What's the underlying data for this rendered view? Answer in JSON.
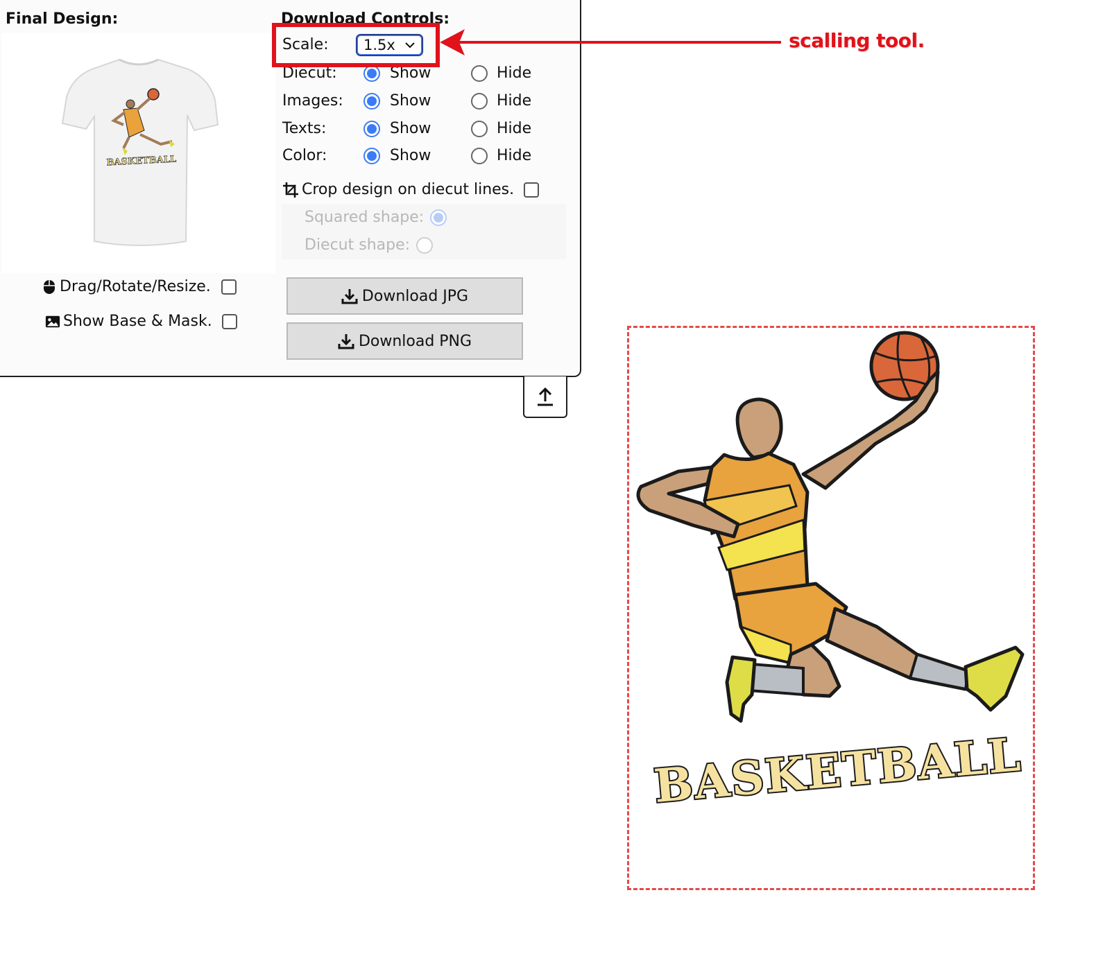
{
  "final_design": {
    "title": "Final Design:",
    "tshirt_print_text": "BASKETBALL",
    "drag_label": "Drag/Rotate/Resize.",
    "show_mask_label": "Show Base & Mask."
  },
  "controls": {
    "title": "Download Controls:",
    "scale_label": "Scale:",
    "scale_value": "1.5x",
    "rows": [
      {
        "label": "Diecut:",
        "show": "Show",
        "hide": "Hide",
        "selected": "Show"
      },
      {
        "label": "Images:",
        "show": "Show",
        "hide": "Hide",
        "selected": "Show"
      },
      {
        "label": "Texts:",
        "show": "Show",
        "hide": "Hide",
        "selected": "Show"
      },
      {
        "label": "Color:",
        "show": "Show",
        "hide": "Hide",
        "selected": "Show"
      }
    ],
    "crop_label": "Crop design on diecut lines.",
    "squared_label": "Squared shape:",
    "diecut_shape_label": "Diecut shape:",
    "download_jpg": "Download JPG",
    "download_png": "Download PNG"
  },
  "annotation": {
    "callout": "scalling tool.",
    "color": "#e0121b"
  },
  "canvas": {
    "design_text": "BASKETBALL",
    "diecut_border_color": "#e34a4a"
  },
  "icons": {
    "mouse": "mouse-icon",
    "image": "image-icon",
    "crop": "crop-icon",
    "download": "download-icon",
    "upload": "upload-icon",
    "chevron": "chevron-down-icon"
  }
}
